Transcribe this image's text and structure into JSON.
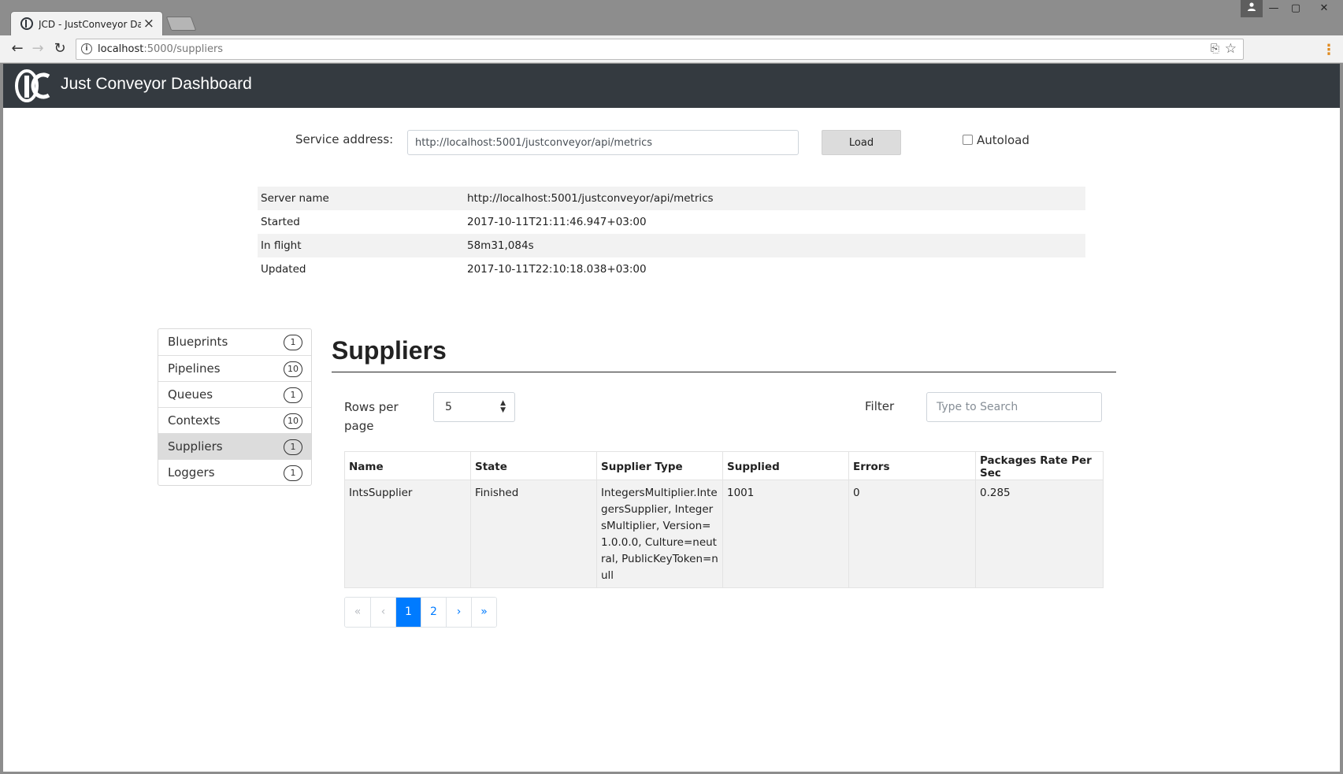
{
  "browser": {
    "tab_title": "JCD - JustConveyor Dash",
    "url_host": "localhost",
    "url_path": ":5000/suppliers",
    "window_controls": {
      "user_icon": "user-icon",
      "minimize": "—",
      "maximize": "▢",
      "close": "✕"
    }
  },
  "app": {
    "title": "Just Conveyor Dashboard",
    "logo_text": "JC"
  },
  "service": {
    "label": "Service address:",
    "value": "http://localhost:5001/justconveyor/api/metrics",
    "load_label": "Load",
    "autoload_label": "Autoload",
    "autoload_checked": false
  },
  "server_info": [
    {
      "key": "Server name",
      "value": "http://localhost:5001/justconveyor/api/metrics"
    },
    {
      "key": "Started",
      "value": "2017-10-11T21:11:46.947+03:00"
    },
    {
      "key": "In flight",
      "value": "58m31,084s"
    },
    {
      "key": "Updated",
      "value": "2017-10-11T22:10:18.038+03:00"
    }
  ],
  "sidebar": {
    "items": [
      {
        "label": "Blueprints",
        "count": "1",
        "active": false
      },
      {
        "label": "Pipelines",
        "count": "10",
        "active": false
      },
      {
        "label": "Queues",
        "count": "1",
        "active": false
      },
      {
        "label": "Contexts",
        "count": "10",
        "active": false
      },
      {
        "label": "Suppliers",
        "count": "1",
        "active": true
      },
      {
        "label": "Loggers",
        "count": "1",
        "active": false
      }
    ]
  },
  "main": {
    "title": "Suppliers",
    "rows_per_page_label": "Rows per page",
    "rows_per_page_value": "5",
    "filter_label": "Filter",
    "filter_placeholder": "Type to Search",
    "table": {
      "columns": [
        "Name",
        "State",
        "Supplier Type",
        "Supplied",
        "Errors",
        "Packages Rate Per Sec"
      ],
      "rows": [
        [
          "IntsSupplier",
          "Finished",
          "IntegersMultiplier.IntegersSupplier, IntegersMultiplier, Version=1.0.0.0, Culture=neutral, PublicKeyToken=null",
          "1001",
          "0",
          "0.285"
        ]
      ]
    },
    "pagination": {
      "first": "«",
      "prev": "‹",
      "pages": [
        "1",
        "2"
      ],
      "current": "1",
      "next": "›",
      "last": "»"
    }
  }
}
